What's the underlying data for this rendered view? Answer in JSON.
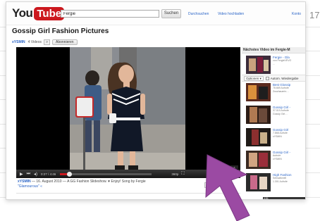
{
  "page_number": "17",
  "colors": {
    "accent": "#cc181e",
    "link": "#2a64c7",
    "cursor": "#9b4aa3"
  },
  "masthead": {
    "logo_you": "You",
    "logo_tube": "Tube",
    "search_value": "Fergie",
    "search_button": "Suchen",
    "links": [
      "Durchsuchen",
      "Video hochladen",
      "Konto"
    ]
  },
  "video": {
    "title": "Gossip Girl Fashion Pictures",
    "channel": "xYSMIN",
    "video_count": "4 Videos",
    "dropdown_icon": "»",
    "subscribe": "Abonnieren"
  },
  "player": {
    "play_icon": "▶",
    "next_icon": "⏭",
    "volume_icon": "◂)",
    "time": "0:27 / 4:46",
    "progress": 0.1,
    "quality": "360p",
    "fullscreen_icon": "⛶",
    "close_icon": "×"
  },
  "description": {
    "uploader": "xYSMIN",
    "date_prefix": "— 16. August 2010 —",
    "text": "A GG Fashion Slideshow. ♥ Enjoy! Song by Fergie",
    "text2": "\"Glamourous\" «",
    "close_icon": "×"
  },
  "sidebar": {
    "header": "Nächstes Video im Fergie-M",
    "next": {
      "title": "Fergie - Gla",
      "meta": [
        "von FergieVEVO",
        "…"
      ]
    },
    "options_label": "Optionen ▾",
    "autoplay_label": "Autom. Wiedergabe",
    "items": [
      {
        "title": "Best Glossip",
        "meta": [
          "78.669 Aufrufe",
          "Zuschauerin…"
        ],
        "time": ""
      },
      {
        "title": "Gossip Girl -",
        "meta": [
          "37.019 Aufrufe",
          "Gossip Girl…"
        ],
        "time": ""
      },
      {
        "title": "Gossip Girl",
        "meta": [
          "7.868 Aufrufe",
          "xYSMIN"
        ],
        "time": ""
      },
      {
        "title": "Gossip Girl -",
        "meta": [
          "Aufrufe",
          "xYSMIN"
        ],
        "time": "4:51"
      },
      {
        "title": "High Fashion",
        "meta": [
          "Sensationell",
          "1.301 Aufrufe"
        ],
        "time": ""
      }
    ]
  }
}
